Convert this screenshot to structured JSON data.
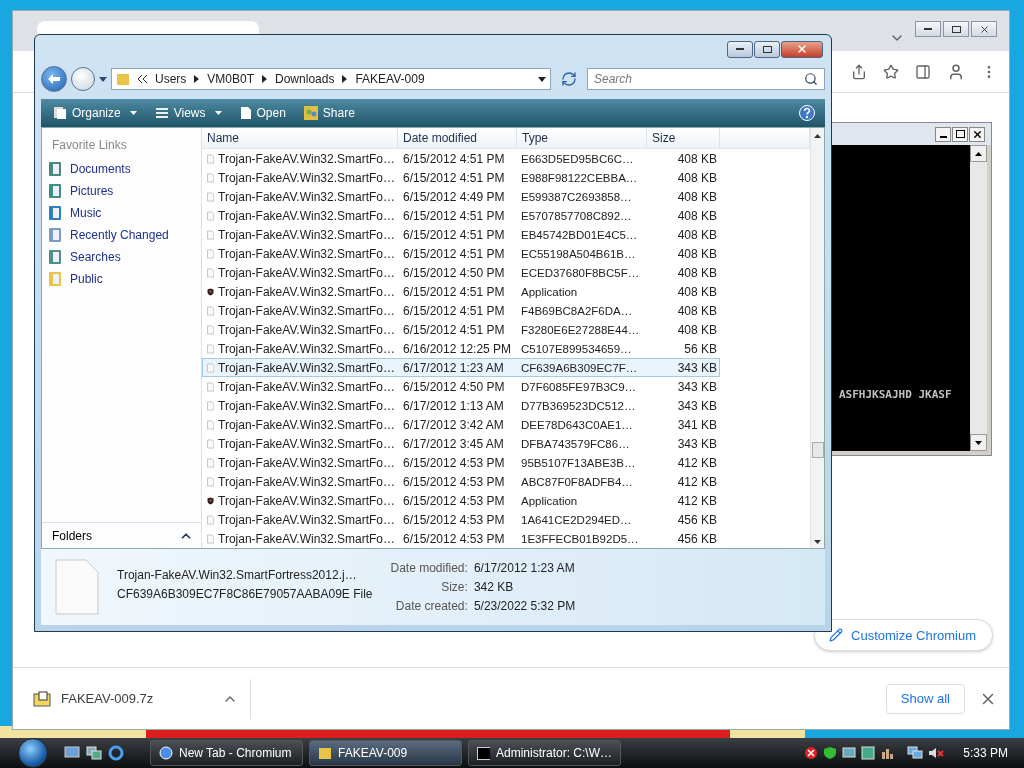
{
  "chromium": {
    "customize_button": "Customize Chromium",
    "download": {
      "file": "FAKEAV-009.7z"
    },
    "show_all": "Show all"
  },
  "console": {
    "output": "ASFHJKSAJHD JKASF"
  },
  "explorer": {
    "breadcrumb": [
      "Users",
      "VM0B0T",
      "Downloads",
      "FAKEAV-009"
    ],
    "search_placeholder": "Search",
    "toolbar": [
      {
        "label": "Organize",
        "kind": "organize",
        "dropdown": true
      },
      {
        "label": "Views",
        "kind": "views",
        "dropdown": true
      },
      {
        "label": "Open",
        "kind": "open",
        "dropdown": false
      },
      {
        "label": "Share",
        "kind": "share",
        "dropdown": false
      }
    ],
    "nav": {
      "title": "Favorite Links",
      "items": [
        {
          "label": "Documents",
          "kind": "documents"
        },
        {
          "label": "Pictures",
          "kind": "pictures"
        },
        {
          "label": "Music",
          "kind": "music"
        },
        {
          "label": "Recently Changed",
          "kind": "recent"
        },
        {
          "label": "Searches",
          "kind": "searches"
        },
        {
          "label": "Public",
          "kind": "folder"
        }
      ],
      "folders": "Folders"
    },
    "columns": [
      "Name",
      "Date modified",
      "Type",
      "Size"
    ],
    "rows": [
      {
        "name": "Trojan-FakeAV.Win32.SmartFo…",
        "date": "6/15/2012 4:51 PM",
        "type": "E663D5ED95BC6C…",
        "size": "408 KB",
        "kind": "file",
        "selected": false
      },
      {
        "name": "Trojan-FakeAV.Win32.SmartFo…",
        "date": "6/15/2012 4:51 PM",
        "type": "E988F98122CEBBA…",
        "size": "408 KB",
        "kind": "file",
        "selected": false
      },
      {
        "name": "Trojan-FakeAV.Win32.SmartFo…",
        "date": "6/15/2012 4:49 PM",
        "type": "E599387C2693858…",
        "size": "408 KB",
        "kind": "file",
        "selected": false
      },
      {
        "name": "Trojan-FakeAV.Win32.SmartFo…",
        "date": "6/15/2012 4:51 PM",
        "type": "E5707857708C892…",
        "size": "408 KB",
        "kind": "file",
        "selected": false
      },
      {
        "name": "Trojan-FakeAV.Win32.SmartFo…",
        "date": "6/15/2012 4:51 PM",
        "type": "EB45742BD01E4C5…",
        "size": "408 KB",
        "kind": "file",
        "selected": false
      },
      {
        "name": "Trojan-FakeAV.Win32.SmartFo…",
        "date": "6/15/2012 4:51 PM",
        "type": "EC55198A504B61B…",
        "size": "408 KB",
        "kind": "file",
        "selected": false
      },
      {
        "name": "Trojan-FakeAV.Win32.SmartFo…",
        "date": "6/15/2012 4:50 PM",
        "type": "ECED37680F8BC5F…",
        "size": "408 KB",
        "kind": "file",
        "selected": false
      },
      {
        "name": "Trojan-FakeAV.Win32.SmartFo…",
        "date": "6/15/2012 4:51 PM",
        "type": "Application",
        "size": "408 KB",
        "kind": "app",
        "selected": false
      },
      {
        "name": "Trojan-FakeAV.Win32.SmartFo…",
        "date": "6/15/2012 4:51 PM",
        "type": "F4B69BC8A2F6DA…",
        "size": "408 KB",
        "kind": "file",
        "selected": false
      },
      {
        "name": "Trojan-FakeAV.Win32.SmartFo…",
        "date": "6/15/2012 4:51 PM",
        "type": "F3280E6E27288E44…",
        "size": "408 KB",
        "kind": "file",
        "selected": false
      },
      {
        "name": "Trojan-FakeAV.Win32.SmartFo…",
        "date": "6/16/2012 12:25 PM",
        "type": "C5107E899534659…",
        "size": "56 KB",
        "kind": "file",
        "selected": false
      },
      {
        "name": "Trojan-FakeAV.Win32.SmartFo…",
        "date": "6/17/2012 1:23 AM",
        "type": "CF639A6B309EC7F…",
        "size": "343 KB",
        "kind": "file",
        "selected": true
      },
      {
        "name": "Trojan-FakeAV.Win32.SmartFo…",
        "date": "6/15/2012 4:50 PM",
        "type": "D7F6085FE97B3C9…",
        "size": "343 KB",
        "kind": "file",
        "selected": false
      },
      {
        "name": "Trojan-FakeAV.Win32.SmartFo…",
        "date": "6/17/2012 1:13 AM",
        "type": "D77B369523DC512…",
        "size": "343 KB",
        "kind": "file",
        "selected": false
      },
      {
        "name": "Trojan-FakeAV.Win32.SmartFo…",
        "date": "6/17/2012 3:42 AM",
        "type": "DEE78D643C0AE1…",
        "size": "341 KB",
        "kind": "file",
        "selected": false
      },
      {
        "name": "Trojan-FakeAV.Win32.SmartFo…",
        "date": "6/17/2012 3:45 AM",
        "type": "DFBA743579FC86…",
        "size": "343 KB",
        "kind": "file",
        "selected": false
      },
      {
        "name": "Trojan-FakeAV.Win32.SmartFo…",
        "date": "6/15/2012 4:53 PM",
        "type": "95B5107F13ABE3B…",
        "size": "412 KB",
        "kind": "file",
        "selected": false
      },
      {
        "name": "Trojan-FakeAV.Win32.SmartFo…",
        "date": "6/15/2012 4:53 PM",
        "type": "ABC87F0F8ADFB4…",
        "size": "412 KB",
        "kind": "file",
        "selected": false
      },
      {
        "name": "Trojan-FakeAV.Win32.SmartFo…",
        "date": "6/15/2012 4:53 PM",
        "type": "Application",
        "size": "412 KB",
        "kind": "app",
        "selected": false
      },
      {
        "name": "Trojan-FakeAV.Win32.SmartFo…",
        "date": "6/15/2012 4:53 PM",
        "type": "1A641CE2D294ED…",
        "size": "456 KB",
        "kind": "file",
        "selected": false
      },
      {
        "name": "Trojan-FakeAV.Win32.SmartFo…",
        "date": "6/15/2012 4:53 PM",
        "type": "1E3FFECB01B92D5…",
        "size": "456 KB",
        "kind": "file",
        "selected": false
      }
    ],
    "details": {
      "name": "Trojan-FakeAV.Win32.SmartFortress2012.j…",
      "type": "CF639A6B309EC7F8C86E79057AABA09E File",
      "fields": [
        {
          "label": "Date modified:",
          "value": "6/17/2012 1:23 AM"
        },
        {
          "label": "Size:",
          "value": "342 KB"
        },
        {
          "label": "Date created:",
          "value": "5/23/2022 5:32 PM"
        }
      ]
    }
  },
  "taskbar": {
    "buttons": [
      {
        "label": "New Tab - Chromium",
        "kind": "browser",
        "selected": false
      },
      {
        "label": "FAKEAV-009",
        "kind": "folder",
        "selected": true
      },
      {
        "label": "Administrator: C:\\W…",
        "kind": "console",
        "selected": false
      }
    ],
    "clock": "5:33 PM"
  }
}
